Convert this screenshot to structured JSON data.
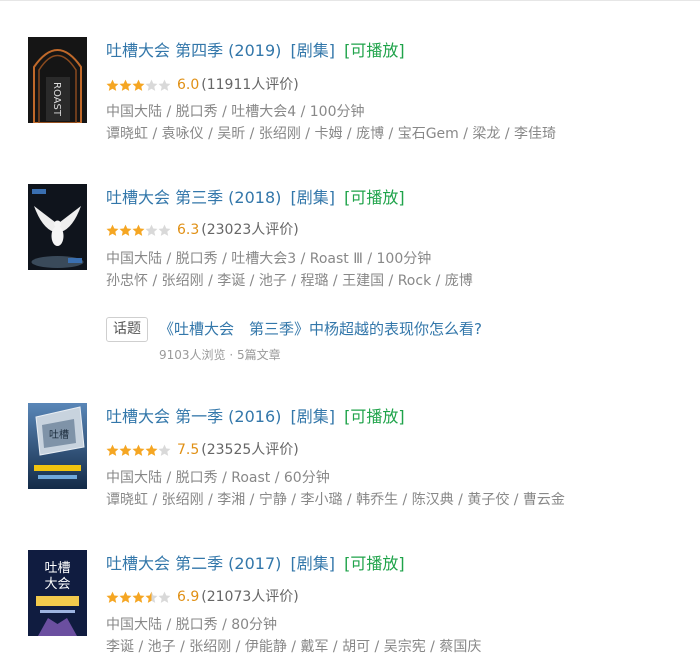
{
  "results": [
    {
      "title": "吐槽大会 第四季 (2019)",
      "tag_series": "[剧集]",
      "tag_play": "[可播放]",
      "rating": 6.0,
      "rating_text": "6.0",
      "rating_count": "(11911人评价)",
      "meta": "中国大陆 / 脱口秀 / 吐槽大会4 / 100分钟",
      "cast": "谭晓虹 / 袁咏仪 / 吴昕 / 张绍刚 / 卡姆 / 庞博 / 宝石Gem / 梁龙 / 李佳琦",
      "poster_icon": "poster-s4",
      "poster_colors": [
        "#1a1a1a",
        "#b35a1f"
      ]
    },
    {
      "title": "吐槽大会 第三季 (2018)",
      "tag_series": "[剧集]",
      "tag_play": "[可播放]",
      "rating": 6.3,
      "rating_text": "6.3",
      "rating_count": "(23023人评价)",
      "meta": "中国大陆 / 脱口秀 / 吐槽大会3 / Roast Ⅲ / 100分钟",
      "cast": "孙忠怀 / 张绍刚 / 李诞 / 池子 / 程璐 / 王建国 / Rock / 庞博",
      "poster_icon": "poster-s3",
      "poster_colors": [
        "#101820",
        "#e8e8e8"
      ]
    },
    {
      "title": "吐槽大会 第一季 (2016)",
      "tag_series": "[剧集]",
      "tag_play": "[可播放]",
      "rating": 7.5,
      "rating_text": "7.5",
      "rating_count": "(23525人评价)",
      "meta": "中国大陆 / 脱口秀 / Roast / 60分钟",
      "cast": "谭晓虹 / 张绍刚 / 李湘 / 宁静 / 李小璐 / 韩乔生 / 陈汉典 / 黄子佼 / 曹云金",
      "poster_icon": "poster-s1",
      "poster_colors": [
        "#1d3f66",
        "#c9d6e3"
      ]
    },
    {
      "title": "吐槽大会 第二季 (2017)",
      "tag_series": "[剧集]",
      "tag_play": "[可播放]",
      "rating": 6.9,
      "rating_text": "6.9",
      "rating_count": "(21073人评价)",
      "meta": "中国大陆 / 脱口秀 / 80分钟",
      "cast": "李诞 / 池子 / 张绍刚 / 伊能静 / 戴军 / 胡可 / 吴宗宪 / 蔡国庆",
      "poster_icon": "poster-s2",
      "poster_colors": [
        "#12204a",
        "#f2c94c"
      ]
    }
  ],
  "topic": {
    "badge": "话题",
    "title": "《吐槽大会　第三季》中杨超越的表现你怎么看?",
    "stats": "9103人浏览 · 5篇文章"
  },
  "colors": {
    "link": "#3377aa",
    "play": "#1fa34a",
    "star_on": "#f5a623",
    "star_off": "#d9d9d9",
    "score": "#e09015",
    "meta": "#888888"
  }
}
